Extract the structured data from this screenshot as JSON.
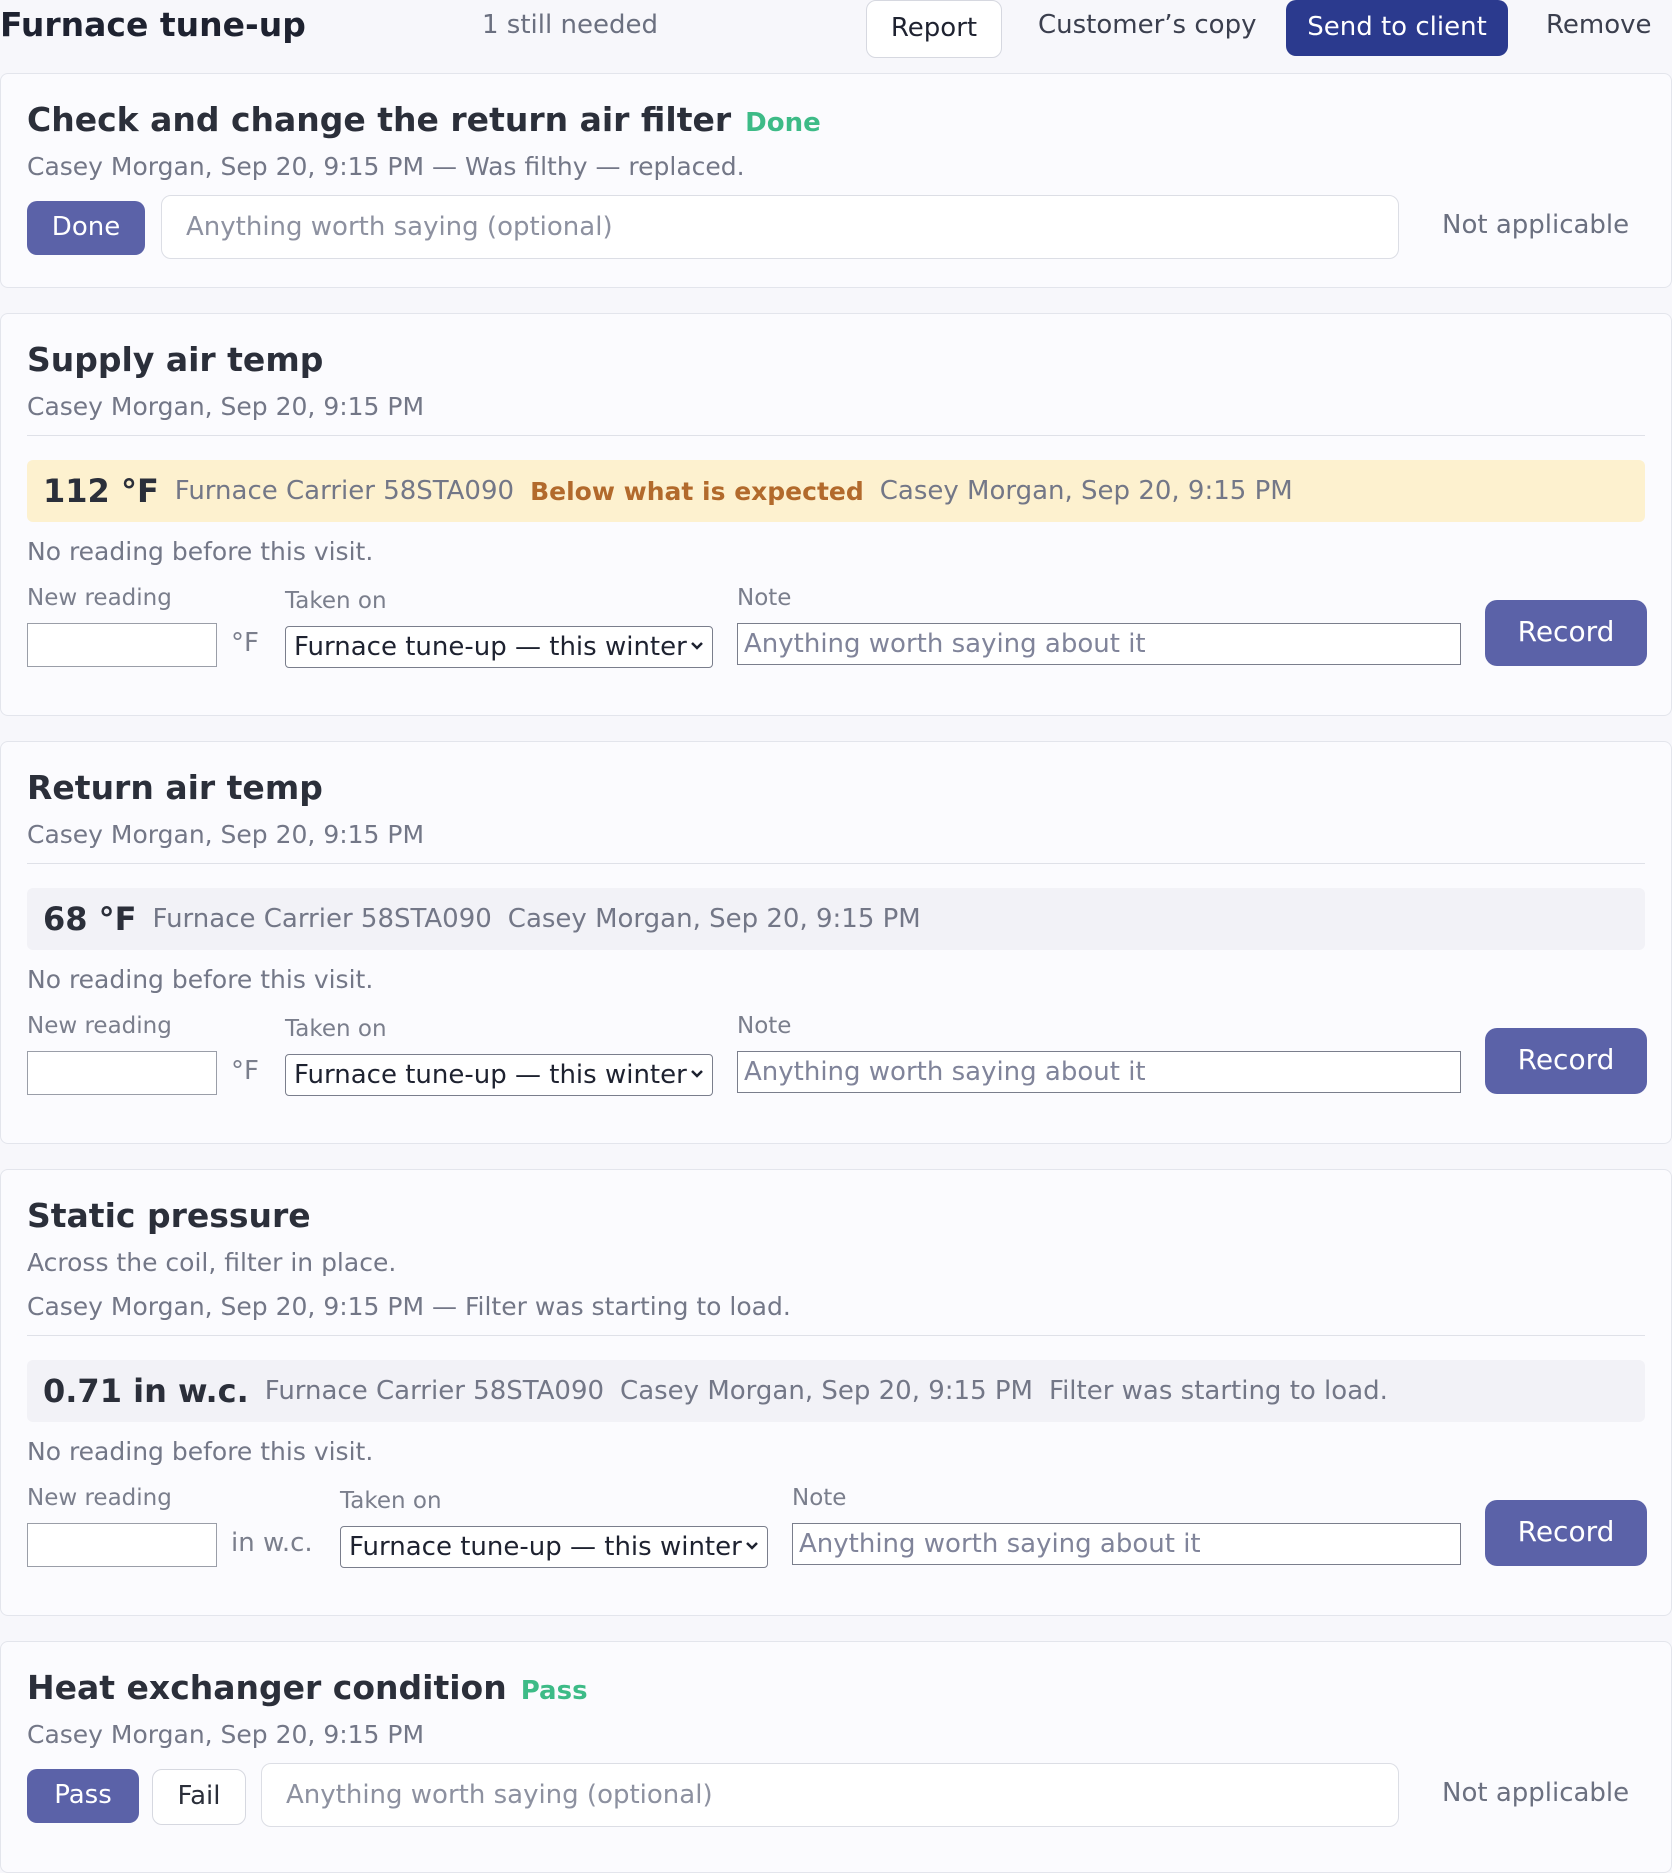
{
  "header": {
    "title": "Furnace tune-up",
    "still_needed": "1 still needed",
    "report_label": "Report",
    "customer_copy_label": "Customer’s copy",
    "send_label": "Send to client",
    "remove_label": "Remove"
  },
  "cards": {
    "filter": {
      "title": "Check and change the return air filter",
      "status": "Done",
      "meta": "Casey Morgan, Sep 20, 9:15 PM — Was filthy — replaced.",
      "done_label": "Done",
      "note_placeholder": "Anything worth saying (optional)",
      "na_label": "Not applicable"
    },
    "supply": {
      "title": "Supply air temp",
      "meta": "Casey Morgan, Sep 20, 9:15 PM",
      "reading": {
        "value": "112 °F",
        "equipment": "Furnace Carrier 58STA090",
        "flag": "Below what is expected",
        "who": "Casey Morgan, Sep 20, 9:15 PM"
      },
      "no_previous": "No reading before this visit.",
      "new_reading_label": "New reading",
      "unit": "°F",
      "taken_on_label": "Taken on",
      "taken_on_value": "Furnace tune-up — this winter",
      "note_label": "Note",
      "note_placeholder": "Anything worth saying about it",
      "record_label": "Record"
    },
    "return": {
      "title": "Return air temp",
      "meta": "Casey Morgan, Sep 20, 9:15 PM",
      "reading": {
        "value": "68 °F",
        "equipment": "Furnace Carrier 58STA090",
        "who": "Casey Morgan, Sep 20, 9:15 PM"
      },
      "no_previous": "No reading before this visit.",
      "new_reading_label": "New reading",
      "unit": "°F",
      "taken_on_label": "Taken on",
      "taken_on_value": "Furnace tune-up — this winter",
      "note_label": "Note",
      "note_placeholder": "Anything worth saying about it",
      "record_label": "Record"
    },
    "static": {
      "title": "Static pressure",
      "description": "Across the coil, filter in place.",
      "meta": "Casey Morgan, Sep 20, 9:15 PM — Filter was starting to load.",
      "reading": {
        "value": "0.71 in w.c.",
        "equipment": "Furnace Carrier 58STA090",
        "who": "Casey Morgan, Sep 20, 9:15 PM",
        "note": "Filter was starting to load."
      },
      "no_previous": "No reading before this visit.",
      "new_reading_label": "New reading",
      "unit": "in w.c.",
      "taken_on_label": "Taken on",
      "taken_on_value": "Furnace tune-up — this winter",
      "note_label": "Note",
      "note_placeholder": "Anything worth saying about it",
      "record_label": "Record"
    },
    "heat": {
      "title": "Heat exchanger condition",
      "status": "Pass",
      "meta": "Casey Morgan, Sep 20, 9:15 PM",
      "pass_label": "Pass",
      "fail_label": "Fail",
      "note_placeholder": "Anything worth saying (optional)",
      "na_label": "Not applicable"
    }
  },
  "colors": {
    "primary": "#5b62a8",
    "send": "#2b3a8e",
    "status_green": "#3dbb87",
    "warning_bg": "#fdf1cf",
    "warning_text": "#b26a2c"
  }
}
